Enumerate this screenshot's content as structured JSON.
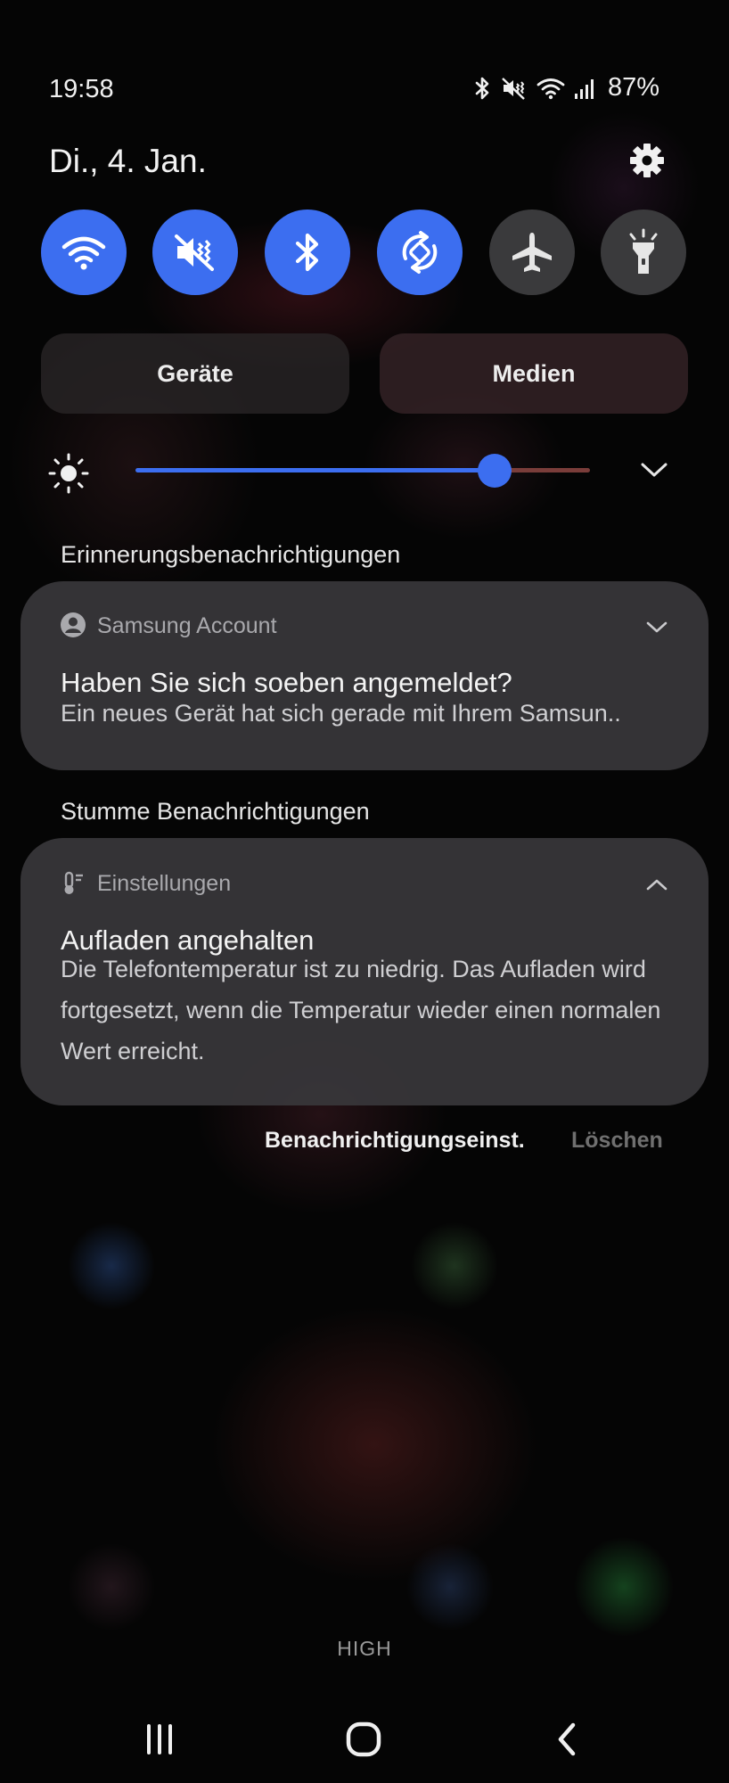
{
  "status_bar": {
    "time": "19:58",
    "battery": "87%",
    "icons": [
      "bluetooth-icon",
      "mute-icon",
      "wifi-icon",
      "signal-icon"
    ]
  },
  "header": {
    "date": "Di., 4. Jan.",
    "settings_icon": "gear-icon"
  },
  "quick_toggles": [
    {
      "icon": "wifi-icon",
      "state": "on"
    },
    {
      "icon": "mute-icon",
      "state": "on"
    },
    {
      "icon": "bluetooth-icon",
      "state": "on"
    },
    {
      "icon": "auto-rotate-icon",
      "state": "on"
    },
    {
      "icon": "airplane-icon",
      "state": "off"
    },
    {
      "icon": "flashlight-icon",
      "state": "off"
    }
  ],
  "buttons": {
    "devices": "Geräte",
    "media": "Medien"
  },
  "brightness": {
    "level": 0.79
  },
  "sections": {
    "reminders": "Erinnerungsbenachrichtigungen",
    "silent": "Stumme Benachrichtigungen"
  },
  "notifications": [
    {
      "app": "Samsung Account",
      "title": "Haben Sie sich soeben angemeldet?",
      "body": "Ein neues Gerät hat sich gerade mit Ihrem Samsun.."
    },
    {
      "app": "Einstellungen",
      "title": "Aufladen angehalten",
      "body": "Die Telefontemperatur ist zu niedrig. Das Aufladen wird fortgesetzt, wenn die Temperatur wieder einen normalen Wert erreicht."
    }
  ],
  "actions": {
    "notification_settings": "Benachrichtigungseinst.",
    "clear": "Löschen"
  },
  "carrier_label": "HIGH",
  "colors": {
    "accent": "#3c6ef0",
    "toggle_off": "#3a3a3c",
    "card": "#38373a"
  }
}
